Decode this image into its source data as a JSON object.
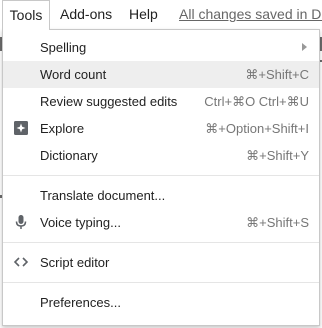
{
  "menubar": {
    "tools": "Tools",
    "addons": "Add-ons",
    "help": "Help",
    "saved_status": "All changes saved in Dr"
  },
  "menu": {
    "items": [
      {
        "label": "Spelling",
        "shortcut": "",
        "has_submenu": true,
        "icon": ""
      },
      {
        "label": "Word count",
        "shortcut": "⌘+Shift+C",
        "has_submenu": false,
        "icon": "",
        "highlighted": true
      },
      {
        "label": "Review suggested edits",
        "shortcut": "Ctrl+⌘O Ctrl+⌘U",
        "has_submenu": false,
        "icon": ""
      },
      {
        "label": "Explore",
        "shortcut": "⌘+Option+Shift+I",
        "has_submenu": false,
        "icon": "explore-icon"
      },
      {
        "label": "Dictionary",
        "shortcut": "⌘+Shift+Y",
        "has_submenu": false,
        "icon": ""
      },
      {
        "label": "Translate document...",
        "shortcut": "",
        "has_submenu": false,
        "icon": ""
      },
      {
        "label": "Voice typing...",
        "shortcut": "⌘+Shift+S",
        "has_submenu": false,
        "icon": "microphone-icon"
      },
      {
        "label": "Script editor",
        "shortcut": "",
        "has_submenu": false,
        "icon": "code-brackets-icon"
      },
      {
        "label": "Preferences...",
        "shortcut": "",
        "has_submenu": false,
        "icon": ""
      }
    ]
  },
  "colors": {
    "highlight": "#eeeeee",
    "text": "#222222",
    "shortcut": "#777777",
    "icon": "#5f6368"
  }
}
